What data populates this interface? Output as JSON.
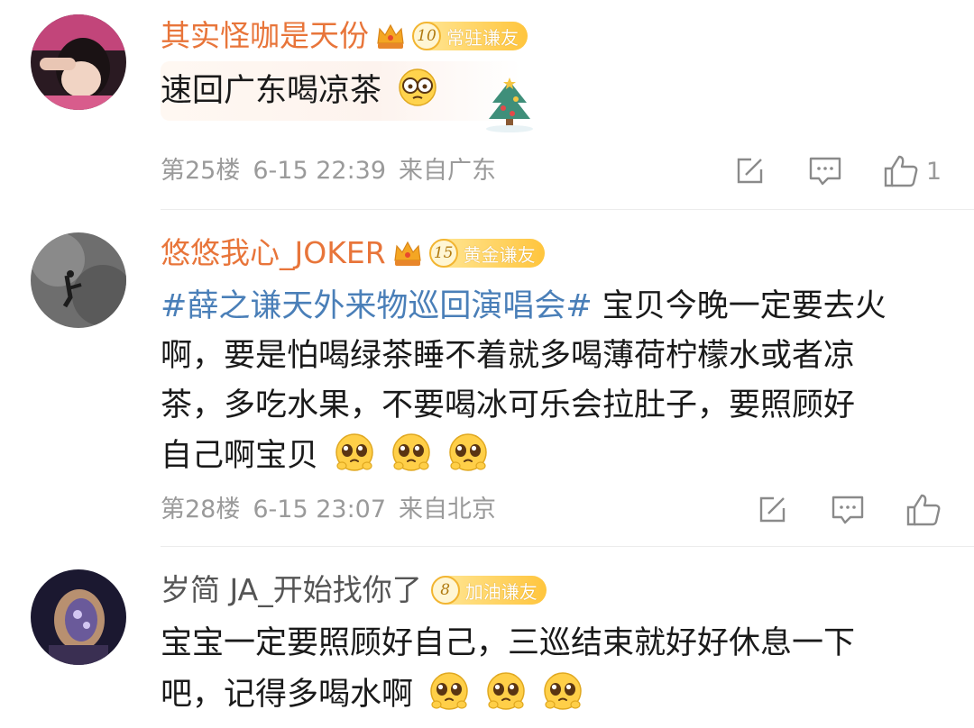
{
  "comments": [
    {
      "username": "其实怪咖是天份",
      "crown_level": "3",
      "badge_level": "10",
      "badge_text": "常驻谦友",
      "text": "速回广东喝凉茶",
      "floor": "第25楼",
      "time": "6-15 22:39",
      "location": "来自广东",
      "like_count": "1"
    },
    {
      "username": "悠悠我心_JOKER",
      "crown_level": "7",
      "badge_level": "15",
      "badge_text": "黄金谦友",
      "hashtag": "#薛之谦天外来物巡回演唱会#",
      "text_line1": " 宝贝今晚一定要去火",
      "text_line2": "啊，要是怕喝绿茶睡不着就多喝薄荷柠檬水或者凉",
      "text_line3": "茶，多吃水果，不要喝冰可乐会拉肚子，要照顾好",
      "text_line4": "自己啊宝贝",
      "floor": "第28楼",
      "time": "6-15 23:07",
      "location": "来自北京"
    },
    {
      "username": "岁简 JA_开始找你了",
      "badge_level": "8",
      "badge_text": "加油谦友",
      "text_line1": "宝宝一定要照顾好自己，三巡结束就好好休息一下",
      "text_line2": "吧，记得多喝水啊"
    }
  ],
  "icons": {
    "edit": "edit-icon",
    "reply": "reply-icon",
    "like": "thumbs-up-icon",
    "emoji_pleading": "pleading-face-emoji",
    "emoji_glasses": "glasses-face-emoji"
  },
  "colors": {
    "username_vip": "#e8753a",
    "hashtag": "#4a7fb8",
    "meta": "#9a9a9a",
    "badge": "#ffc53d"
  }
}
